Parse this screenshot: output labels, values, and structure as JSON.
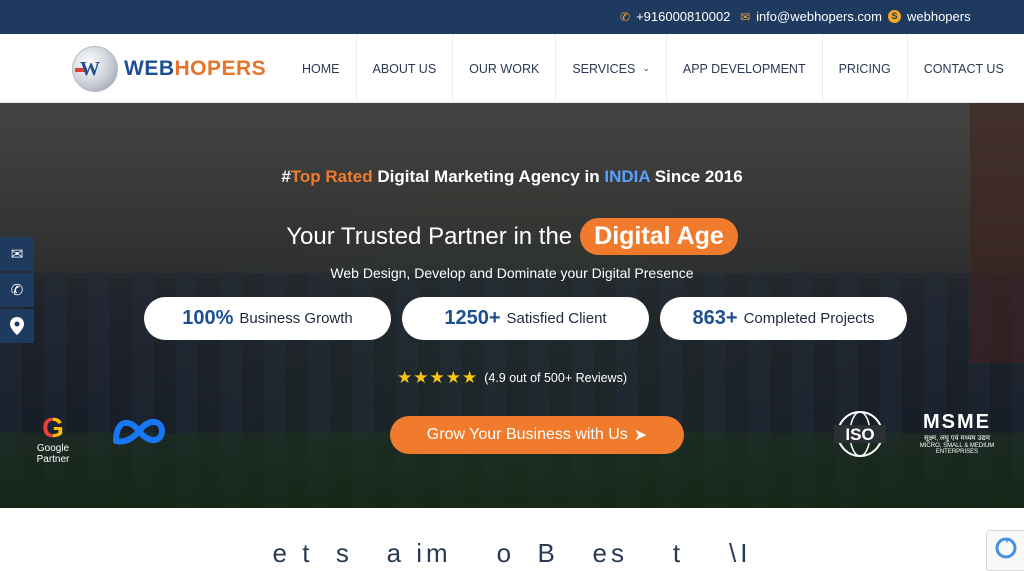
{
  "topbar": {
    "phone": "+916000810002",
    "email": "info@webhopers.com",
    "skype": "webhopers",
    "icons": [
      "phone-icon",
      "mail-icon",
      "skype-icon"
    ]
  },
  "logo": {
    "mark": "W",
    "text_1": "WEB",
    "text_2": "HOPERS"
  },
  "nav": {
    "items": [
      {
        "label": "HOME"
      },
      {
        "label": "ABOUT US"
      },
      {
        "label": "OUR WORK"
      },
      {
        "label": "SERVICES"
      },
      {
        "label": "APP DEVELOPMENT"
      },
      {
        "label": "PRICING"
      },
      {
        "label": "CONTACT US"
      }
    ]
  },
  "hero": {
    "tag_hash": "#",
    "tag_hl1": "Top Rated",
    "tag_mid": " Digital Marketing Agency in ",
    "tag_hl2": "INDIA",
    "tag_end": " Since 2016",
    "headline": "Your Trusted Partner in the",
    "headline_pill": "Digital Age",
    "subline": "Web Design, Develop and Dominate your Digital Presence",
    "stats": [
      {
        "num": "100%",
        "label": "Business Growth"
      },
      {
        "num": "1250+",
        "label": "Satisfied Client"
      },
      {
        "num": "863+",
        "label": "Completed Projects"
      }
    ],
    "rating_stars": "★★★★★",
    "rating_text": "(4.9 out of 500+ Reviews)",
    "cta": "Grow Your Business with Us",
    "google_letter": "G",
    "google_label": "Google Partner",
    "iso_label": "ISO",
    "msme_big": "MSME",
    "msme_hindi": "सूक्ष्म, लघु एवं मध्यम उद्यम",
    "msme_small": "MICRO, SMALL & MEDIUM ENTERPRISES"
  },
  "sidebar": [
    "mail-icon",
    "phone-icon",
    "location-icon"
  ],
  "bottom": {
    "scramble": "e t  s   a im    o  B   es    t    \\I"
  },
  "colors": {
    "navy": "#1f3a5f",
    "orange": "#f07b2c",
    "blue": "#1d4f91"
  }
}
